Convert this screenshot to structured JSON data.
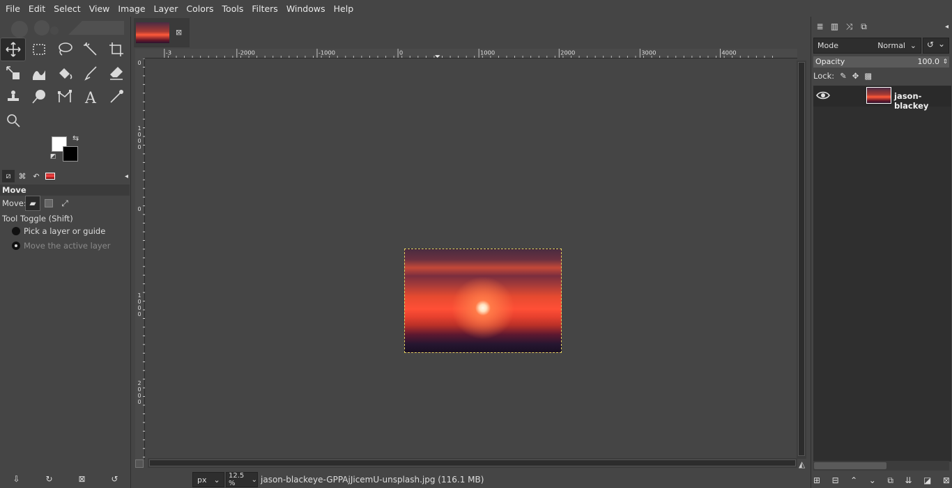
{
  "menu": [
    "File",
    "Edit",
    "Select",
    "View",
    "Image",
    "Layer",
    "Colors",
    "Tools",
    "Filters",
    "Windows",
    "Help"
  ],
  "toolbox": {
    "tools": [
      "move-tool",
      "rect-select-tool",
      "free-select-tool",
      "fuzzy-select-tool",
      "crop-tool",
      "unified-transform-tool",
      "warp-transform-tool",
      "bucket-fill-tool",
      "paintbrush-tool",
      "eraser-tool",
      "clone-tool",
      "smudge-tool",
      "paths-tool",
      "text-tool",
      "color-picker-tool",
      "zoom-tool"
    ],
    "active_tool": "move-tool",
    "fg_color": "#ffffff",
    "bg_color": "#000000"
  },
  "tool_options": {
    "title": "Move",
    "move_label": "Move:",
    "tool_toggle": "Tool Toggle  (Shift)",
    "option_pick": "Pick a layer or guide",
    "option_active": "Move the active layer",
    "selected_option": "Move the active layer"
  },
  "ruler": {
    "h_labels": [
      "-3",
      "-2000",
      "-1000",
      "0",
      "1000",
      "2000",
      "3000",
      "4000"
    ],
    "v_labels": [
      [
        "0"
      ],
      [
        "1",
        "0",
        "0",
        "0"
      ],
      [
        "0"
      ],
      [
        "1",
        "0",
        "0",
        "0"
      ],
      [
        "2",
        "0",
        "0",
        "0"
      ]
    ]
  },
  "image": {
    "tab_close": "⊠",
    "filename": "jason-blackeye-GPPAjJicemU-unsplash.jpg (116.1 MB)"
  },
  "status": {
    "unit": "px",
    "zoom": "12.5 %"
  },
  "layers_panel": {
    "mode_label": "Mode",
    "mode_value": "Normal",
    "opacity_label": "Opacity",
    "opacity_value": "100.0",
    "lock_label": "Lock:",
    "layer_name": "jason-blackey"
  }
}
